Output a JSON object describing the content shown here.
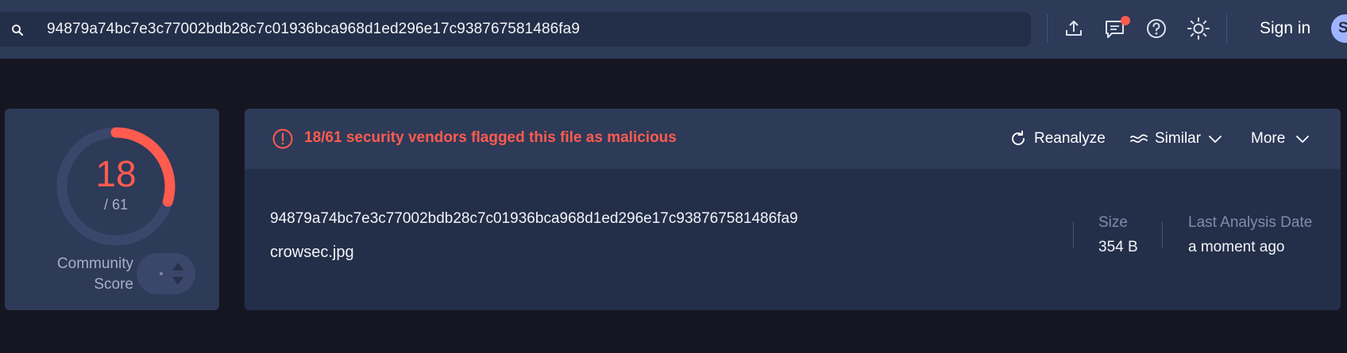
{
  "search": {
    "value": "94879a74bc7e3c77002bdb28c7c01936bca968d1ed296e17c938767581486fa9",
    "icon": "search-icon"
  },
  "header": {
    "icons": [
      "upload-icon",
      "chat-icon",
      "help-icon",
      "theme-sun-icon"
    ],
    "sign_in_label": "Sign in",
    "avatar_initial": "S"
  },
  "detection": {
    "score": "18",
    "total_label": "/ 61",
    "malicious": 18,
    "total": 61,
    "accent_color": "#ff5b4f"
  },
  "community": {
    "label_line1": "Community",
    "label_line2": "Score"
  },
  "alert": {
    "text": "18/61 security vendors flagged this file as malicious",
    "color": "#ff5b4f"
  },
  "actions": {
    "reanalyze": "Reanalyze",
    "similar": "Similar",
    "more": "More"
  },
  "file": {
    "hash": "94879a74bc7e3c77002bdb28c7c01936bca968d1ed296e17c938767581486fa9",
    "name": "crowsec.jpg"
  },
  "meta": {
    "size_label": "Size",
    "size_value": "354 B",
    "date_label": "Last Analysis Date",
    "date_value": "a moment ago"
  }
}
